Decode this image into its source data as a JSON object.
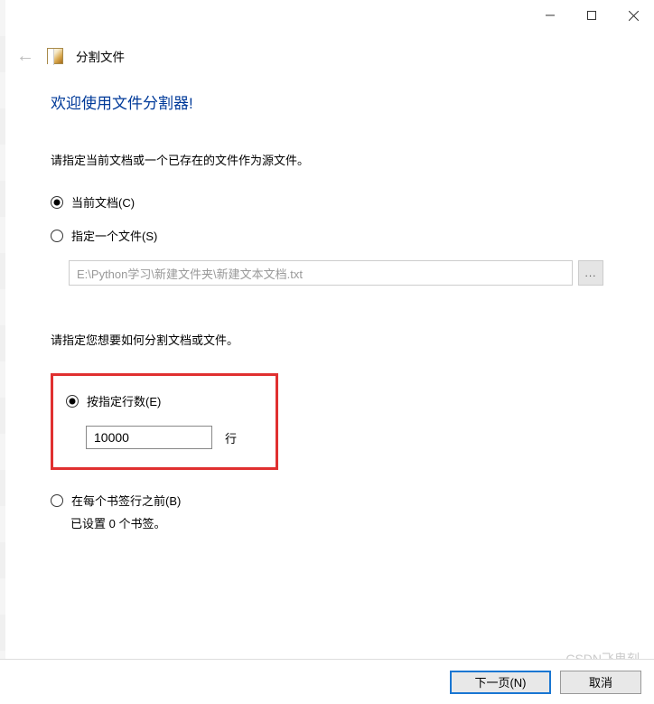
{
  "window": {
    "title": "分割文件"
  },
  "content": {
    "welcome_heading": "欢迎使用文件分割器!",
    "source_instruction": "请指定当前文档或一个已存在的文件作为源文件。",
    "radio_current_doc": "当前文档(C)",
    "radio_specify_file": "指定一个文件(S)",
    "file_path": "E:\\Python学习\\新建文件夹\\新建文本文档.txt",
    "browse_label": "...",
    "split_instruction": "请指定您想要如何分割文档或文件。",
    "radio_by_lines": "按指定行数(E)",
    "lines_value": "10000",
    "lines_unit": "行",
    "radio_before_bookmark": "在每个书签行之前(B)",
    "bookmark_status": "已设置 0 个书签。"
  },
  "footer": {
    "next_label": "下一页(N)",
    "cancel_label": "取消"
  },
  "watermark": "CSDN飞鬼刻"
}
